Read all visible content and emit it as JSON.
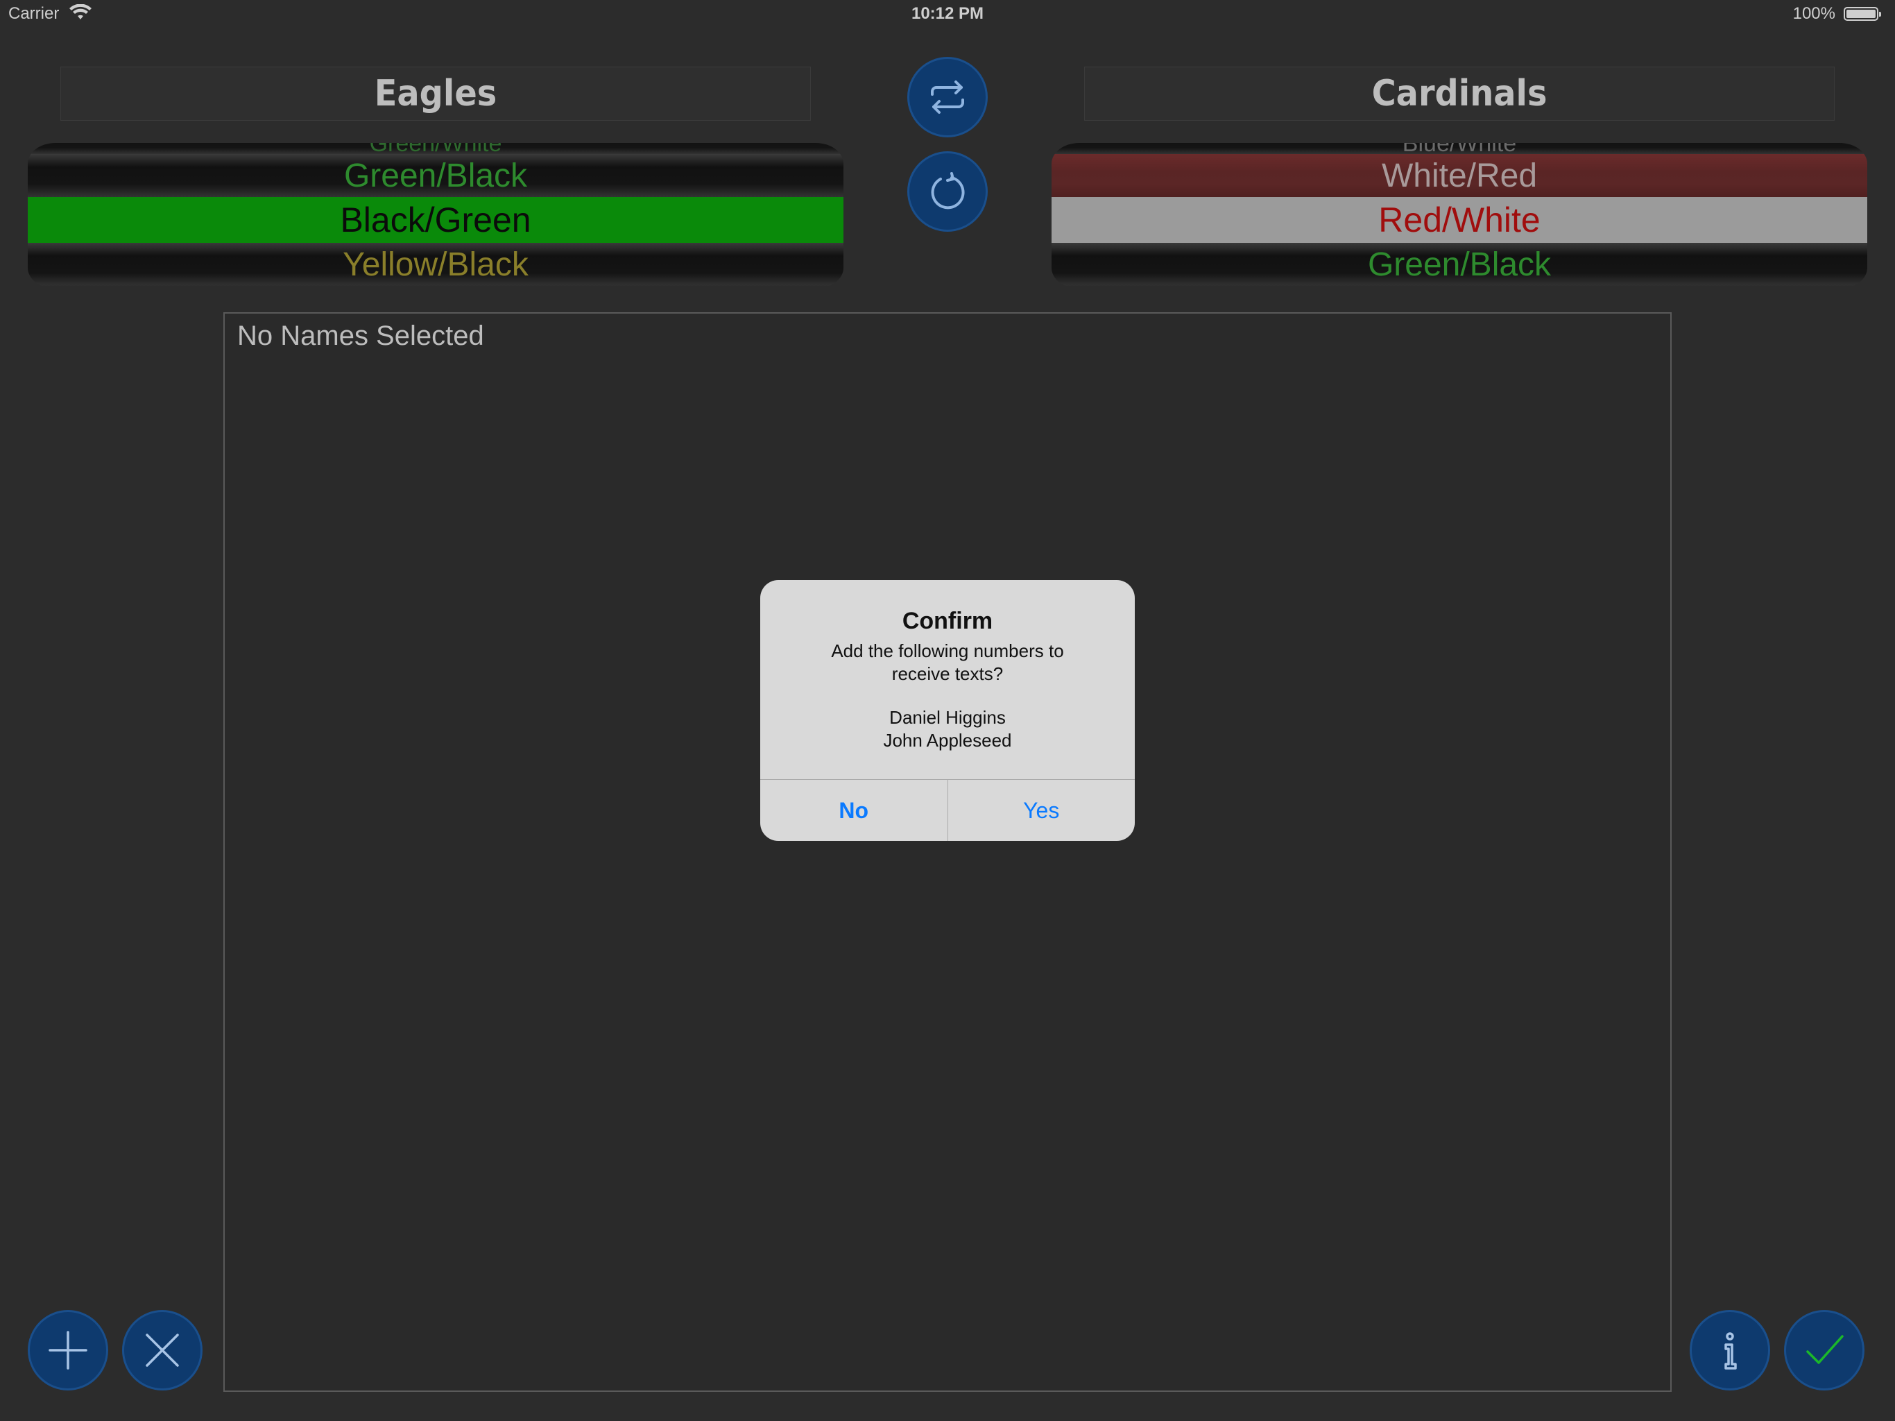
{
  "status_bar": {
    "carrier": "Carrier",
    "time": "10:12 PM",
    "battery": "100%"
  },
  "teams": {
    "left": {
      "name": "Eagles",
      "picker": {
        "top_peek": "Green/White",
        "above": "Green/Black",
        "selected": "Black/Green",
        "below": "Yellow/Black"
      },
      "colors": {
        "above_text": "#2e8b2e",
        "selected_bg": "#0a8a0a",
        "selected_text": "#0b0b0b",
        "below_text": "#8a7f2a"
      }
    },
    "right": {
      "name": "Cardinals",
      "picker": {
        "top_peek": "Blue/White",
        "above": "White/Red",
        "selected": "Red/White",
        "below": "Green/Black"
      },
      "colors": {
        "above_text": "#a89a9a",
        "selected_bg": "#9b9b9b",
        "selected_text": "#a00d0d",
        "below_text": "#2e8b2e"
      }
    }
  },
  "icons": {
    "swap": "swap-icon",
    "refresh": "refresh-icon",
    "add": "plus-icon",
    "remove": "close-icon",
    "info": "info-icon",
    "confirm": "checkmark-icon"
  },
  "names_panel": {
    "text": "No Names Selected"
  },
  "alert": {
    "title": "Confirm",
    "message": "Add the following numbers to receive texts?",
    "names": [
      "Daniel  Higgins",
      "John  Appleseed"
    ],
    "no_label": "No",
    "yes_label": "Yes"
  },
  "accent": {
    "button_bg": "#0e3a6e",
    "checkmark": "#1bb82a",
    "alert_link": "#0a7aff"
  }
}
